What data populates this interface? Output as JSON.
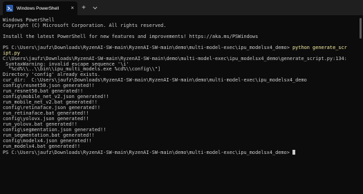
{
  "tab": {
    "title": "Windows PowerShell",
    "icon": "powershell-icon",
    "close_glyph": "×"
  },
  "titlebar": {
    "newtab_glyph": "+",
    "dropdown_icon": "chevron-down-icon"
  },
  "terminal": {
    "lines": [
      "Windows PowerShell",
      "Copyright (C) Microsoft Corporation. All rights reserved.",
      "",
      "Install the latest PowerShell for new features and improvements! https://aka.ms/PSWindows",
      "",
      "PS C:\\Users\\jaufz\\Downloads\\RyzenAI-SW-main\\RyzenAI-SW-main\\demo\\multi-model-exec\\ipu_modelsx4_demo> ",
      "ipt.py",
      "C:\\Users\\jaufz\\Downloads\\RyzenAI-SW-main\\RyzenAI-SW-main\\demo\\multi-model-exec\\ipu_modelsx4_demo\\generate_script.py:134:",
      " SyntaxWarning: invalid escape sequence '\\i'",
      "  \"%cd%\\\\..\\\\bin\\\\ipu_multi_models.exe %cd%\\\\config\\\\\"]",
      "Directory 'config' already exists.",
      "cur_dir:  C:\\Users\\jaufz\\Downloads\\RyzenAI-SW-main\\RyzenAI-SW-main\\demo\\multi-model-exec\\ipu_modelsx4_demo",
      "config\\resnet50.json generated!!",
      "run_resnet50.bat generated!!",
      "config\\mobile_net_v2.json generated!!",
      "run_mobile_net_v2.bat generated!!",
      "config\\retinaface.json generated!!",
      "run_retinaface.bat generated!!",
      "config\\yolovx.json generated!!",
      "run_yolovx.bat generated!!",
      "config\\segmentation.json generated!!",
      "run_segmentation.bat generated!!",
      "config\\modelx4.json generated!!",
      "run_modelx4.bat generated!!",
      "PS C:\\Users\\jaufz\\Downloads\\RyzenAI-SW-main\\RyzenAI-SW-main\\demo\\multi-model-exec\\ipu_modelsx4_demo> "
    ],
    "command": "python generate_scr"
  },
  "colors": {
    "background": "#0c0c0c",
    "titlebar": "#1f1f1f",
    "text": "#cccccc",
    "command": "#f9f1a5"
  }
}
